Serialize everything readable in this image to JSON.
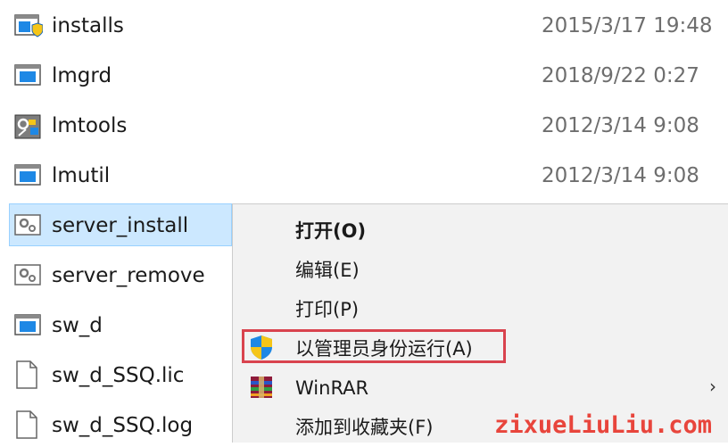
{
  "files": [
    {
      "name": "installs",
      "date": "2015/3/17 19:48",
      "icon": "app-window-shield-icon"
    },
    {
      "name": "lmgrd",
      "date": "2018/9/22 0:27",
      "icon": "app-window-icon"
    },
    {
      "name": "lmtools",
      "date": "2012/3/14 9:08",
      "icon": "lmtools-app-icon"
    },
    {
      "name": "lmutil",
      "date": "2012/3/14 9:08",
      "icon": "app-window-icon"
    },
    {
      "name": "server_install",
      "date": "",
      "icon": "batch-file-gear-icon"
    },
    {
      "name": "server_remove",
      "date": "",
      "icon": "batch-file-gear-icon"
    },
    {
      "name": "sw_d",
      "date": "",
      "icon": "app-window-icon"
    },
    {
      "name": "sw_d_SSQ.lic",
      "date": "",
      "icon": "blank-document-icon"
    },
    {
      "name": "sw_d_SSQ.log",
      "date": "",
      "icon": "blank-document-icon"
    }
  ],
  "context_menu": {
    "open": "打开(O)",
    "edit": "编辑(E)",
    "print": "打印(P)",
    "run_as_admin": "以管理员身份运行(A)",
    "winrar": "WinRAR",
    "add_favorites": "添加到收藏夹(F)"
  },
  "watermark": "zixueLiuLiu.com",
  "colors": {
    "selection_bg": "#cce8ff",
    "highlight_border": "#d9434e",
    "watermark": "#e8453c"
  }
}
